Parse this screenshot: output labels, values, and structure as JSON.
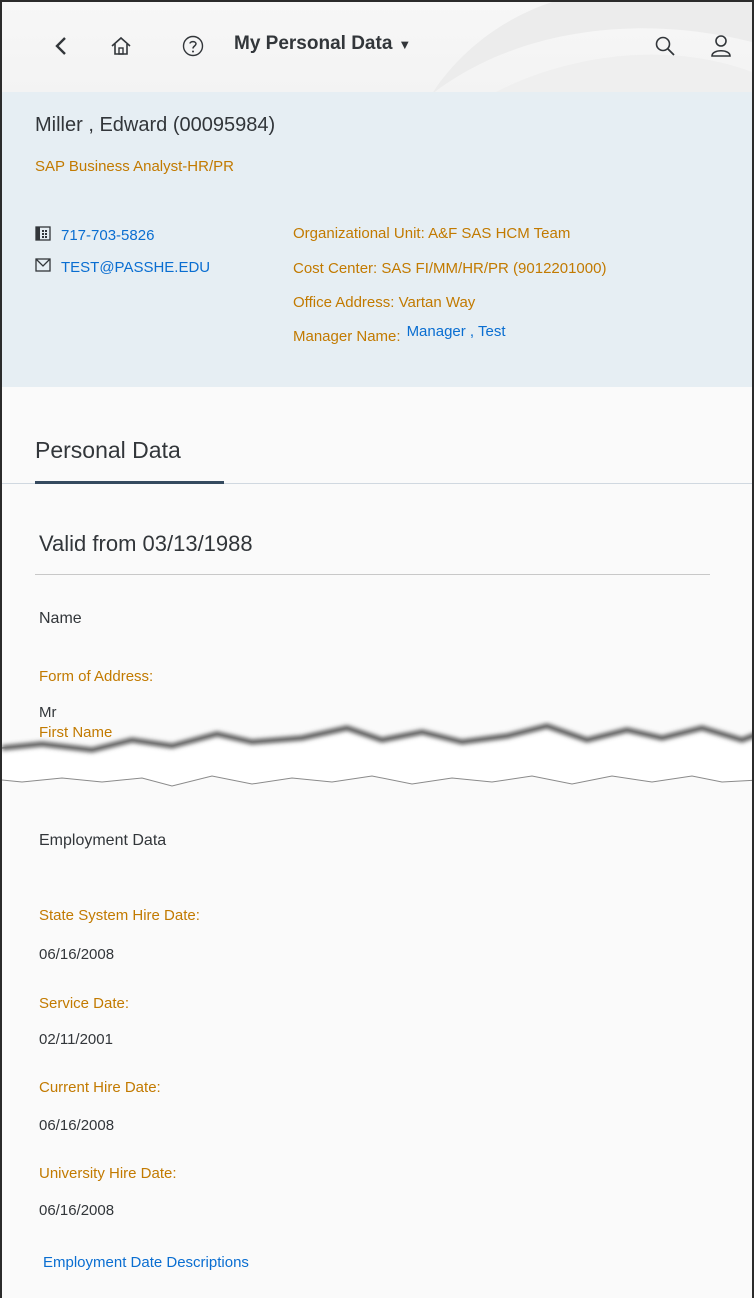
{
  "shell": {
    "back_icon": "chevron-left-icon",
    "home_icon": "home-icon",
    "help_icon": "help-icon",
    "title": "My Personal Data",
    "caret": "▼",
    "search_icon": "search-icon",
    "user_icon": "user-icon"
  },
  "header": {
    "name": "Miller , Edward (00095984)",
    "job_title": "SAP Business Analyst-HR/PR",
    "phone": "717-703-5826",
    "email": "TEST@PASSHE.EDU",
    "org_unit": "Organizational Unit: A&F SAS HCM Team",
    "cost_center": "Cost Center: SAS FI/MM/HR/PR (9012201000)",
    "office": "Office Address: Vartan Way",
    "manager_label": "Manager Name:",
    "manager_link": "Manager , Test"
  },
  "section": {
    "tab": "Personal Data",
    "subsection": "Valid from 03/13/1988"
  },
  "name_group": {
    "title": "Name",
    "form_label": "Form of Address:",
    "form_value": "Mr",
    "first_name_label": "First Name"
  },
  "employment": {
    "title": "Employment Data",
    "fields": [
      {
        "label": "State System Hire Date:",
        "value": "06/16/2008"
      },
      {
        "label": "Service Date:",
        "value": "02/11/2001"
      },
      {
        "label": "Current Hire Date:",
        "value": "06/16/2008"
      },
      {
        "label": "University Hire Date:",
        "value": "06/16/2008"
      }
    ],
    "descriptions_link": "Employment Date Descriptions"
  },
  "colors": {
    "label": "#c27a00",
    "link": "#0a6ed1",
    "text": "#32363a",
    "header_bg": "#e6eef3"
  }
}
